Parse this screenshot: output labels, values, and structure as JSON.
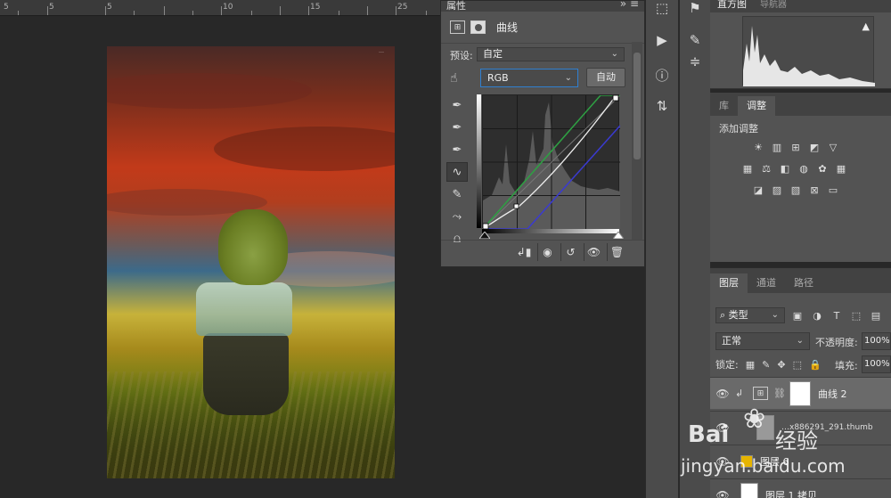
{
  "ruler": {
    "ticks": [
      "5",
      "5",
      "10",
      "15",
      "20",
      "25"
    ]
  },
  "photo": {
    "watermark": "…"
  },
  "properties": {
    "tab_label": "属性",
    "title": "曲线",
    "preset_label": "预设:",
    "preset_value": "自定",
    "channel_value": "RGB",
    "auto_label": "自动"
  },
  "histogram": {
    "tab1": "直方图",
    "tab2": "导航器"
  },
  "adjustments": {
    "tabs": [
      "库",
      "调整"
    ],
    "add_label": "添加调整"
  },
  "layers": {
    "tabs": [
      "图层",
      "通道",
      "路径"
    ],
    "filter_value": "类型",
    "blend_value": "正常",
    "opacity_label": "不透明度:",
    "opacity_value": "100%",
    "lock_label": "锁定:",
    "fill_label": "填充:",
    "fill_value": "100%",
    "items": [
      {
        "name": "曲线 2"
      },
      {
        "name": "…x886291_291.thumb"
      },
      {
        "name": "图层 6"
      },
      {
        "name": "图层 1 拷贝"
      }
    ]
  },
  "watermark": {
    "logo": "Bai",
    "brand": "经验",
    "url": "jingyan.baidu.com"
  }
}
